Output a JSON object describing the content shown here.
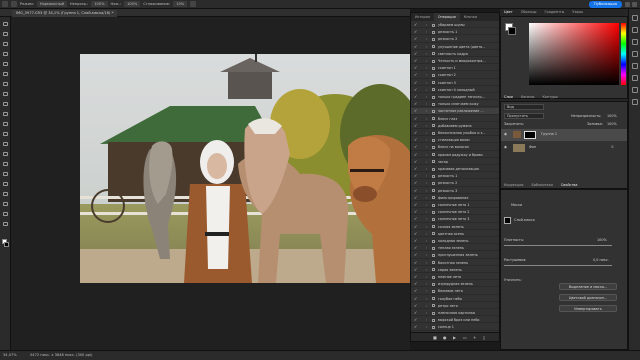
{
  "topbar": {
    "mode_label": "Режим:",
    "mode_value": "Нормальный",
    "opacity_label": "Непрозр.:",
    "opacity_value": "100%",
    "flow_label": "Наж.:",
    "flow_value": "100%",
    "smoothing_label": "Сглаживание:",
    "smoothing_value": "10%",
    "publish_label": "Публикация"
  },
  "document": {
    "tab_title": "IMG_5977.CR3 @ 34,1% (Группа 1, Слой-маска/16) *"
  },
  "status": {
    "zoom": "34,07%",
    "doc_info": "5472 пикс. x 3648 пикс. (300 ppi)"
  },
  "actions_panel": {
    "tabs": [
      "История",
      "Операции",
      "Кнопки"
    ],
    "active_tab": "Операции",
    "items": [
      "убираем шумы",
      "резкость 1",
      "резкость 2",
      "улучшение цвета (цвета...",
      "светлость кадра",
      "Четкость и микроконтра...",
      "скинтон 1",
      "скинтон 2",
      "скинтон 3",
      "скинтон 4 холодный",
      "только градиен тенсотр...",
      "только смягчаем кожу",
      "частотное разложение ...",
      "блеск глаз",
      "добавляем румяна",
      "белоснежная улыбка и з...",
      "стилизация волос",
      "блеск на волосах",
      "красим радужку и брови",
      "загар",
      "красивая детализация",
      "резкость 1",
      "резкость 2",
      "резкость 3",
      "фильтрирование",
      "солнечное лето 1",
      "солнечное лето 2",
      "солнечное лето 3",
      "сочная зелень",
      "цветная осень",
      "холодная зелень",
      "теплая зелень",
      "приглушенная зелень",
      "болотная зелень",
      "серая зелень",
      "нежное лето",
      "изумрудная зелень",
      "бежевое лето",
      "голубое небо",
      "ретро лето",
      "пленочная картинка",
      "морской бриз или небо",
      "солнце 1",
      "солнце 2"
    ]
  },
  "color_panel": {
    "tabs": [
      "Цвет",
      "Образцы",
      "Градиенты",
      "Узоры"
    ],
    "hue_color": "#ff0000"
  },
  "layers_panel": {
    "tabs": [
      "Слои",
      "Каналы",
      "Контуры"
    ],
    "search_placeholder": "Вид",
    "blend_mode": "Пропустить",
    "opacity_label": "Непрозрачность:",
    "opacity_value": "100%",
    "lock_label": "Закрепить:",
    "fill_label": "Заливка:",
    "fill_value": "100%",
    "layers": [
      {
        "name": "Группа 1"
      },
      {
        "name": "Фон"
      }
    ]
  },
  "properties_panel": {
    "tabs": [
      "Коррекция",
      "Библиотеки",
      "Свойства"
    ],
    "active_tab": "Свойства",
    "section_title": "Маски",
    "mask_label": "Слой-маска",
    "density_label": "Плотность:",
    "density_value": "100%",
    "feather_label": "Растушевка:",
    "feather_value": "0,0 пикс.",
    "refine_label": "Уточнить:",
    "select_mask_button": "Выделение и маска...",
    "color_range_button": "Цветовой диапазон...",
    "invert_button": "Инвертировать"
  }
}
